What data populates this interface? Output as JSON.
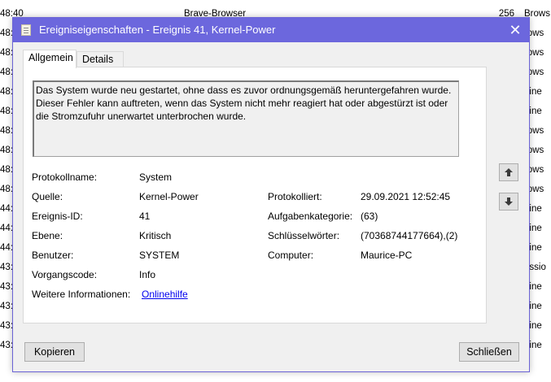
{
  "background": {
    "rows": [
      {
        "time": "48:40",
        "source": "Brave-Browser",
        "num": "256",
        "cat": "Brows"
      },
      {
        "time": "48:",
        "source": "",
        "num": "",
        "cat": "rows"
      },
      {
        "time": "48:",
        "source": "",
        "num": "",
        "cat": "rows"
      },
      {
        "time": "48:",
        "source": "",
        "num": "",
        "cat": "rows"
      },
      {
        "time": "48:",
        "source": "",
        "num": "",
        "cat": "eine"
      },
      {
        "time": "48:",
        "source": "",
        "num": "",
        "cat": "eine"
      },
      {
        "time": "48:",
        "source": "",
        "num": "",
        "cat": "rows"
      },
      {
        "time": "48:",
        "source": "",
        "num": "",
        "cat": "rows"
      },
      {
        "time": "48:",
        "source": "",
        "num": "",
        "cat": "rows"
      },
      {
        "time": "48:",
        "source": "",
        "num": "",
        "cat": "rows"
      },
      {
        "time": "44:",
        "source": "",
        "num": "",
        "cat": "eine"
      },
      {
        "time": "44:",
        "source": "",
        "num": "",
        "cat": "eine"
      },
      {
        "time": "44:",
        "source": "",
        "num": "",
        "cat": "eine"
      },
      {
        "time": "43:",
        "source": "",
        "num": "",
        "cat": "essio"
      },
      {
        "time": "43:",
        "source": "",
        "num": "",
        "cat": "eine"
      },
      {
        "time": "43:",
        "source": "",
        "num": "",
        "cat": "eine"
      },
      {
        "time": "43:",
        "source": "",
        "num": "",
        "cat": "eine"
      },
      {
        "time": "43:",
        "source": "",
        "num": "",
        "cat": "eine"
      }
    ]
  },
  "dialog": {
    "title": "Ereigniseigenschaften - Ereignis 41, Kernel-Power",
    "close_glyph": "✕",
    "tabs": [
      {
        "label": "Allgemein"
      },
      {
        "label": "Details"
      }
    ],
    "description": [
      "Das System wurde neu gestartet, ohne dass es zuvor ordnungsgemäß heruntergefahren wurde.",
      "Dieser Fehler kann auftreten, wenn das System nicht mehr reagiert hat oder abgestürzt ist oder die Stromzufuhr unerwartet unterbrochen wurde."
    ],
    "fields": {
      "protokollname_label": "Protokollname:",
      "protokollname_value": "System",
      "quelle_label": "Quelle:",
      "quelle_value": "Kernel-Power",
      "protokolliert_label": "Protokolliert:",
      "protokolliert_value": "29.09.2021 12:52:45",
      "ereignis_label": "Ereignis-ID:",
      "ereignis_value": "41",
      "aufgaben_label": "Aufgabenkategorie:",
      "aufgaben_value": "(63)",
      "ebene_label": "Ebene:",
      "ebene_value": "Kritisch",
      "schluessel_label": "Schlüsselwörter:",
      "schluessel_value": "(70368744177664),(2)",
      "benutzer_label": "Benutzer:",
      "benutzer_value": "SYSTEM",
      "computer_label": "Computer:",
      "computer_value": "Maurice-PC",
      "vorgang_label": "Vorgangscode:",
      "vorgang_value": "Info",
      "weitere_label": "Weitere Informationen:",
      "weitere_link": "Onlinehilfe"
    },
    "buttons": {
      "copy": "Kopieren",
      "close": "Schließen"
    },
    "icons": {
      "up": "arrow-up-icon",
      "down": "arrow-down-icon"
    },
    "colors": {
      "titlebar": "#6c67dd",
      "link": "#0000ee"
    }
  }
}
